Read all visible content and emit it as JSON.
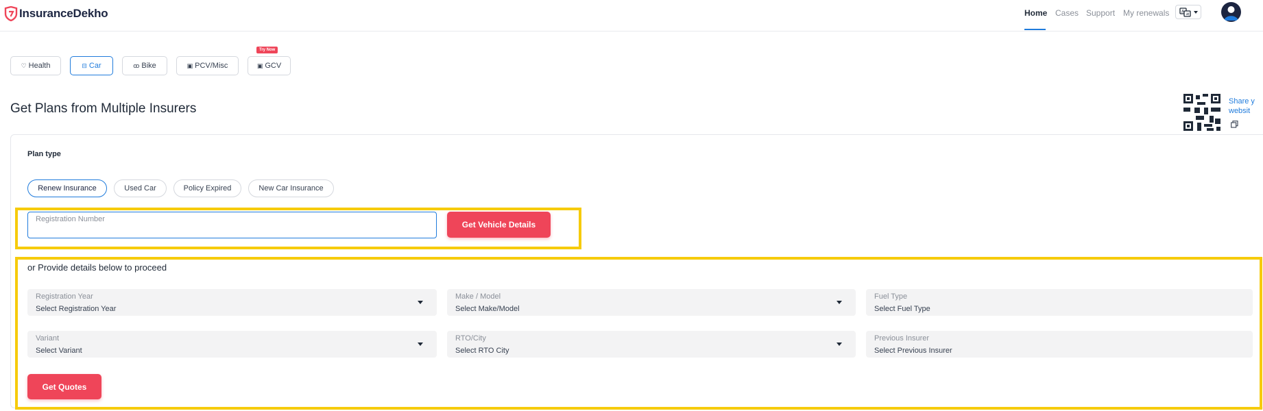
{
  "header": {
    "brand": "InsuranceDekho",
    "nav": [
      {
        "label": "Home",
        "active": true
      },
      {
        "label": "Cases",
        "active": false
      },
      {
        "label": "Support",
        "active": false
      },
      {
        "label": "My renewals",
        "active": false
      }
    ],
    "language_icon": "language-icon",
    "avatar_icon": "user-avatar-icon"
  },
  "categories": [
    {
      "label": "Health",
      "icon": "heart-icon",
      "active": false
    },
    {
      "label": "Car",
      "icon": "car-icon",
      "active": true
    },
    {
      "label": "Bike",
      "icon": "bike-icon",
      "active": false
    },
    {
      "label": "PCV/Misc",
      "icon": "bus-icon",
      "active": false
    },
    {
      "label": "GCV",
      "icon": "truck-icon",
      "active": false,
      "badge": "Try Now"
    }
  ],
  "page_title": "Get Plans from Multiple Insurers",
  "share": {
    "text_line1": "Share y",
    "text_line2": "websit",
    "qr_icon": "qr-code-icon",
    "copy_icon": "copy-icon"
  },
  "plan_type": {
    "label": "Plan type",
    "options": [
      {
        "label": "Renew Insurance",
        "active": true
      },
      {
        "label": "Used Car",
        "active": false
      },
      {
        "label": "Policy Expired",
        "active": false
      },
      {
        "label": "New Car Insurance",
        "active": false
      }
    ]
  },
  "registration": {
    "label": "Registration Number",
    "value": "",
    "button": "Get Vehicle Details"
  },
  "details": {
    "intro": "or Provide details below to proceed",
    "fields": [
      {
        "label": "Registration Year",
        "placeholder": "Select Registration Year",
        "dropdown": true
      },
      {
        "label": "Make / Model",
        "placeholder": "Select Make/Model",
        "dropdown": true
      },
      {
        "label": "Fuel Type",
        "placeholder": "Select Fuel Type",
        "dropdown": false
      },
      {
        "label": "Variant",
        "placeholder": "Select Variant",
        "dropdown": true
      },
      {
        "label": "RTO/City",
        "placeholder": "Select RTO City",
        "dropdown": true
      },
      {
        "label": "Previous Insurer",
        "placeholder": "Select Previous Insurer",
        "dropdown": false
      }
    ],
    "submit": "Get Quotes"
  },
  "colors": {
    "accent": "#1f7bdc",
    "primary_button": "#ef4559",
    "highlight": "#f6cb0c",
    "brand_dark": "#1c2541"
  }
}
